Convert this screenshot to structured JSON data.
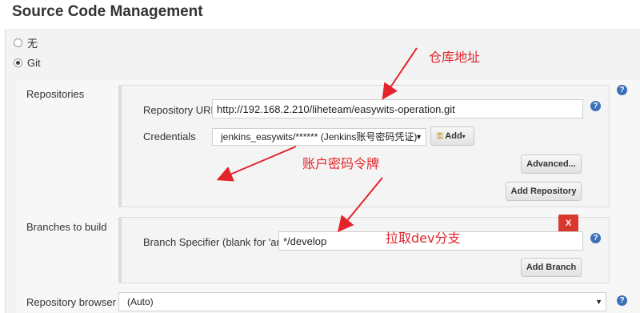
{
  "section_title": "Source Code Management",
  "scm_options": [
    {
      "label": "无",
      "selected": false
    },
    {
      "label": "Git",
      "selected": true
    }
  ],
  "repositories": {
    "label": "Repositories",
    "url_label": "Repository URL",
    "url_value": "http://192.168.2.210/liheteam/easywits-operation.git",
    "credentials_label": "Credentials",
    "credentials_value": "jenkins_easywits/****** (Jenkins账号密码凭证)",
    "add_button": "Add",
    "advanced_button": "Advanced...",
    "add_repository_button": "Add Repository"
  },
  "branches": {
    "label": "Branches to build",
    "delete_button": "X",
    "specifier_label": "Branch Specifier (blank for 'any')",
    "specifier_value": "*/develop",
    "add_branch_button": "Add Branch"
  },
  "repository_browser": {
    "label": "Repository browser",
    "value": "(Auto)"
  },
  "annotations": {
    "repo_address": "仓库地址",
    "account_password": "账户密码令牌",
    "pull_branch": "拉取dev分支"
  },
  "help_icon_text": "?",
  "colors": {
    "annotation": "#e3242b",
    "help_icon": "#3b6fb6",
    "delete_button": "#d9382f"
  }
}
